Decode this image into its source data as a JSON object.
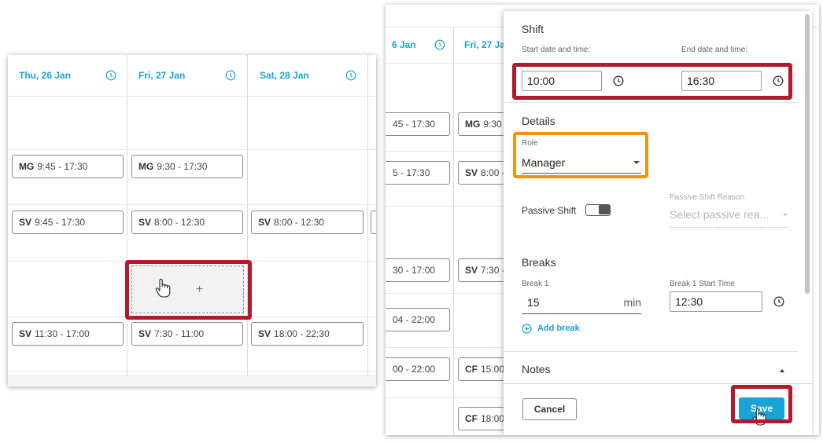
{
  "calendar_left": {
    "days": [
      {
        "label": "Thu, 26 Jan"
      },
      {
        "label": "Fri, 27 Jan"
      },
      {
        "label": "Sat, 28 Jan"
      }
    ],
    "shifts": {
      "thu_row2": {
        "code": "MG",
        "time": "9:45 - 17:30"
      },
      "fri_row2": {
        "code": "MG",
        "time": "9:30 - 17:30"
      },
      "thu_row3": {
        "code": "SV",
        "time": "9:45 - 17:30"
      },
      "fri_row3": {
        "code": "SV",
        "time": "8:00 - 12:30"
      },
      "sat_row3": {
        "code": "SV",
        "time": "8:00 - 12:30"
      },
      "thu_row5": {
        "code": "SV",
        "time": "11:30 - 17:00"
      },
      "fri_row5": {
        "code": "SV",
        "time": "7:30 - 11:00"
      },
      "sat_row5": {
        "code": "SV",
        "time": "18:00 - 22:30"
      }
    },
    "add_slot_symbol": "+"
  },
  "calendar_right": {
    "days": [
      {
        "label": "6 Jan"
      },
      {
        "label": "Fri, 27 Jan"
      }
    ],
    "shifts": {
      "a1": "45 - 17:30",
      "a2": "5 - 17:30",
      "a3": "30 - 17:00",
      "a4": "04 - 22:00",
      "a5": "00 - 22:00",
      "b1": {
        "code": "MG",
        "time": "9:30 -"
      },
      "b2": {
        "code": "SV",
        "time": "8:00 -"
      },
      "b3": {
        "code": "SV",
        "time": "7:30 -"
      },
      "b4": {
        "code": "CF",
        "time": "15:00 -"
      },
      "b5": {
        "code": "CF",
        "time": "18:00 -"
      }
    }
  },
  "shift_modal": {
    "shift_title": "Shift",
    "start_label": "Start date and time:",
    "end_label": "End date and time:",
    "start_value": "10:00",
    "end_value": "16:30",
    "details_title": "Details",
    "role_label": "Role",
    "role_value": "Manager",
    "passive_shift_label": "Passive Shift",
    "passive_shift_on": false,
    "passive_reason_label": "Passive Shift Reason",
    "passive_reason_placeholder": "Select passive rea...",
    "breaks_title": "Breaks",
    "break1_label": "Break 1",
    "break1_value": "15",
    "break1_unit": "min",
    "break1_start_label": "Break 1 Start Time",
    "break1_start_value": "12:30",
    "add_break_label": "Add break",
    "notes_title": "Notes",
    "cancel_label": "Cancel",
    "save_label": "Save"
  },
  "colors": {
    "accent": "#1aa3d4",
    "highlight_red": "#b5192e",
    "highlight_orange": "#f0930a"
  }
}
